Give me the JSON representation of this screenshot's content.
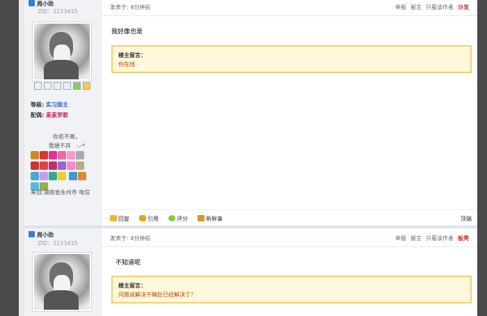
{
  "posts": [
    {
      "username": "周小劲",
      "zid": "ZID：2233415",
      "level_label": "等级:",
      "level": "实习版主",
      "partner_label": "配偶:",
      "partner": "素素梦歌",
      "signature": [
        "你若不离，",
        "我便不弃　-.-*"
      ],
      "from": "来自:湖南省永州市 电信",
      "time": "发表于: 4分钟前",
      "ops": [
        "举报",
        "留言",
        "只看该作者"
      ],
      "floor": "沙发",
      "content": "我好像也是",
      "note_title": "楼主留言：",
      "note_text": "你在线",
      "actions": [
        "回复",
        "引用",
        "评分",
        "新鲜事"
      ],
      "top": "顶端"
    },
    {
      "username": "周小劲",
      "zid": "ZID：2233415",
      "time": "发表于: 4分钟前",
      "ops": [
        "举报",
        "留言",
        "只看该作者"
      ],
      "floor": "板凳",
      "content": "不知道呢",
      "note_title": "楼主留言：",
      "note_text": "问题说解决干嘛肚已经解决了？"
    }
  ],
  "colors": {
    "accent": "#3366cc",
    "floor": "#cc3333",
    "note_bg": "#fff8dc",
    "note_border": "#f0cf74"
  }
}
